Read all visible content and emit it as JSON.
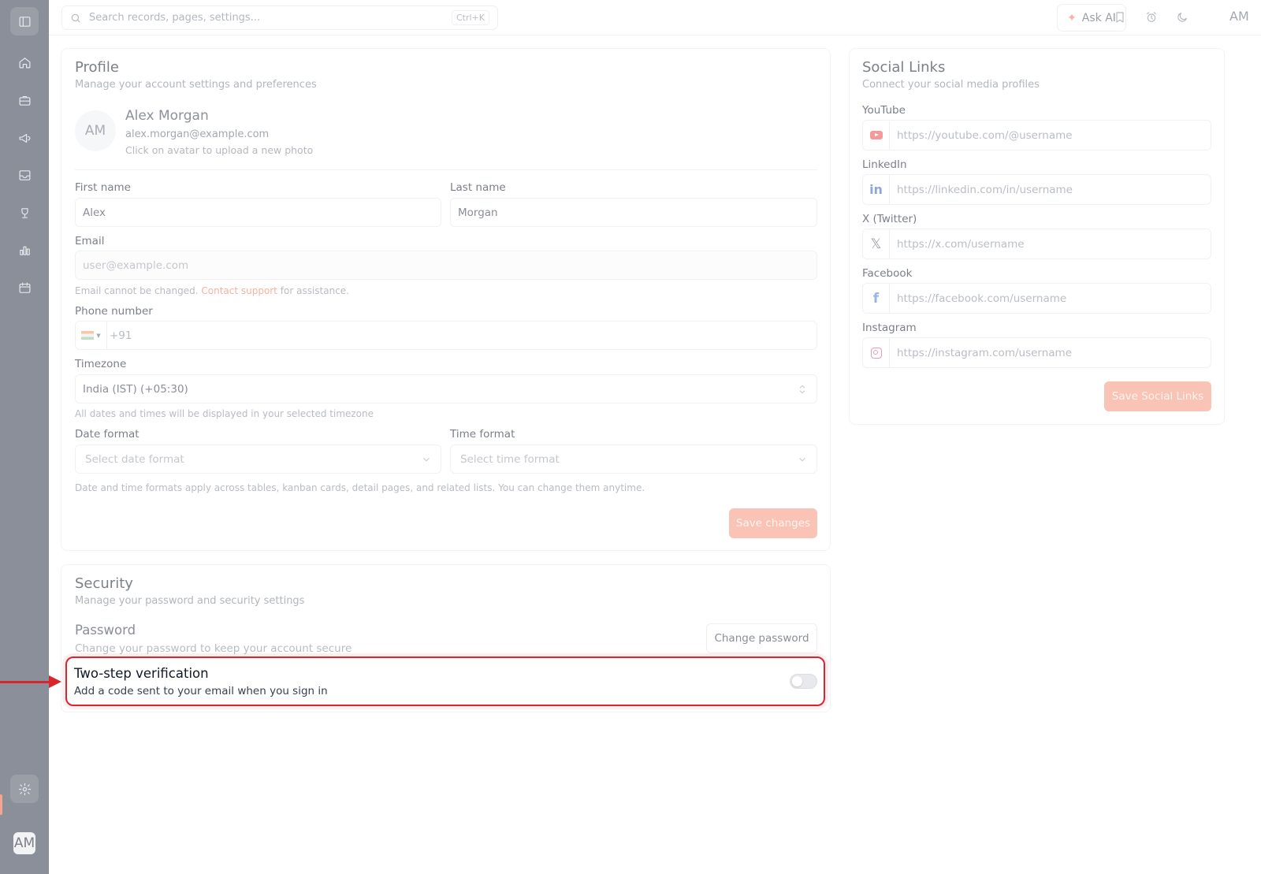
{
  "topbar": {
    "search_placeholder": "Search records, pages, settings...",
    "search_shortcut": "Ctrl+K",
    "ask_ai_label": "Ask AI",
    "avatar_initials": "AM"
  },
  "sidebar": {
    "avatar_initials": "AM",
    "icons": [
      "sidebar-toggle-icon",
      "home-icon",
      "briefcase-icon",
      "megaphone-icon",
      "inbox-icon",
      "trophy-icon",
      "bar-chart-icon",
      "calendar-icon",
      "gear-icon"
    ]
  },
  "profile": {
    "title": "Profile",
    "subtitle": "Manage your account settings and preferences",
    "avatar_initials": "AM",
    "name": "Alex Morgan",
    "email_display": "alex.morgan@example.com",
    "avatar_hint": "Click on avatar to upload a new photo",
    "first_name_label": "First name",
    "first_name_value": "Alex",
    "last_name_label": "Last name",
    "last_name_value": "Morgan",
    "email_label": "Email",
    "email_placeholder": "user@example.com",
    "email_hint_prefix": "Email cannot be changed.",
    "email_hint_link": "Contact support",
    "email_hint_suffix": "for assistance.",
    "phone_label": "Phone number",
    "phone_prefix": "+91",
    "timezone_label": "Timezone",
    "timezone_value": "India (IST) (+05:30)",
    "timezone_hint": "All dates and times will be displayed in your selected timezone",
    "date_format_label": "Date format",
    "date_format_placeholder": "Select date format",
    "time_format_label": "Time format",
    "time_format_placeholder": "Select time format",
    "format_hint": "Date and time formats apply across tables, kanban cards, detail pages, and related lists. You can change them anytime.",
    "save_label": "Save changes"
  },
  "social": {
    "title": "Social Links",
    "subtitle": "Connect your social media profiles",
    "youtube_label": "YouTube",
    "youtube_placeholder": "https://youtube.com/@username",
    "linkedin_label": "LinkedIn",
    "linkedin_placeholder": "https://linkedin.com/in/username",
    "twitter_label": "X (Twitter)",
    "twitter_placeholder": "https://x.com/username",
    "facebook_label": "Facebook",
    "facebook_placeholder": "https://facebook.com/username",
    "instagram_label": "Instagram",
    "instagram_placeholder": "https://instagram.com/username",
    "save_label": "Save Social Links"
  },
  "security": {
    "title": "Security",
    "subtitle": "Manage your password and security settings",
    "password_title": "Password",
    "password_sub": "Change your password to keep your account secure",
    "change_password_label": "Change password",
    "two_step_title": "Two-step verification",
    "two_step_sub": "Add a code sent to your email when you sign in",
    "two_step_enabled": false
  },
  "colors": {
    "accent": "#f4a58f",
    "highlight": "#d8252e",
    "sidebar": "#8b8f99"
  }
}
